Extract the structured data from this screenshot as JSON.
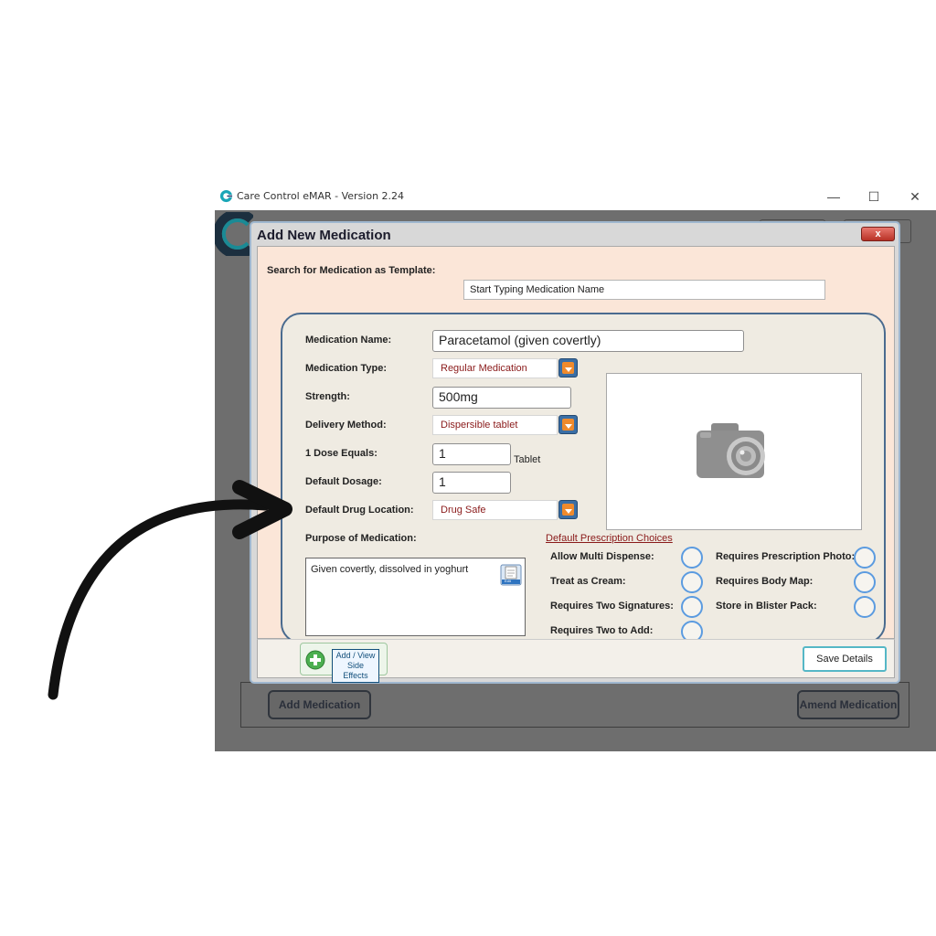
{
  "window": {
    "title": "Care Control eMAR - Version 2.24",
    "minimize_glyph": "—",
    "maximize_glyph": "☐",
    "close_glyph": "✕"
  },
  "background": {
    "add_medication_label": "Add Medication",
    "amend_medication_label": "Amend Medication"
  },
  "dialog": {
    "title": "Add New Medication",
    "close_glyph": "x",
    "search": {
      "label": "Search for Medication as Template:",
      "value": "Start Typing Medication Name"
    },
    "fields": {
      "medication_name_label": "Medication Name:",
      "medication_name_value": "Paracetamol (given covertly)",
      "medication_type_label": "Medication Type:",
      "medication_type_value": "Regular Medication",
      "strength_label": "Strength:",
      "strength_value": "500mg",
      "delivery_method_label": "Delivery Method:",
      "delivery_method_value": "Dispersible tablet",
      "dose_equals_label": "1 Dose Equals:",
      "dose_equals_value": "1",
      "dose_unit": "Tablet",
      "default_dosage_label": "Default Dosage:",
      "default_dosage_value": "1",
      "drug_location_label": "Default Drug Location:",
      "drug_location_value": "Drug Safe",
      "purpose_label": "Purpose of Medication:",
      "purpose_value": "Given covertly, dissolved in yoghurt",
      "edit_icon_text": "Edit"
    },
    "prescription": {
      "heading": "Default Prescription Choices",
      "left": [
        "Allow Multi Dispense:",
        "Treat as Cream:",
        "Requires Two Signatures:",
        "Requires Two to Add:"
      ],
      "right": [
        "Requires Prescription Photo:",
        "Requires Body Map:",
        "Store in Blister Pack:"
      ]
    },
    "footer": {
      "side_effects_label": "Add / View Side Effects",
      "save_label": "Save Details"
    }
  },
  "colors": {
    "dropdown_value": "#8a1a1a",
    "panel_border": "#4a6b8f",
    "radio_border": "#5b9be0",
    "save_border": "#55b7c6"
  }
}
